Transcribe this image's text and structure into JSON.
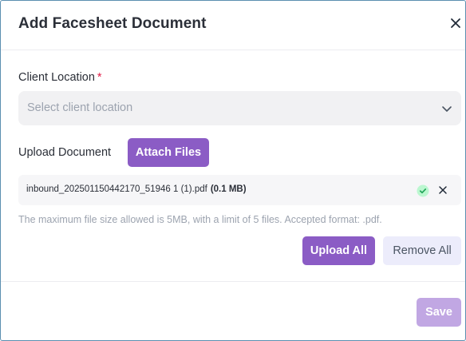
{
  "dialog": {
    "title": "Add Facesheet Document"
  },
  "client_location": {
    "label": "Client Location",
    "required_mark": "*",
    "placeholder": "Select client location"
  },
  "upload": {
    "label": "Upload Document",
    "attach_button": "Attach Files",
    "files": [
      {
        "name": "inbound_202501150442170_51946 1 (1).pdf",
        "size": "(0.1 MB)",
        "status": "uploaded-check"
      }
    ],
    "helper_text": "The maximum file size allowed is 5MB, with a limit of 5 files. Accepted format: .pdf.",
    "upload_all_button": "Upload All",
    "remove_all_button": "Remove All"
  },
  "footer": {
    "save_button": "Save"
  },
  "icons": {
    "close": "close-icon",
    "chevron": "chevron-down-icon",
    "check": "check-circle-icon",
    "remove_file": "close-icon"
  },
  "colors": {
    "primary": "#8b5cc5",
    "primary_disabled": "#c1a7e3",
    "secondary_bg": "#ececfb",
    "success": "#22c55e",
    "required": "#e11d48"
  }
}
